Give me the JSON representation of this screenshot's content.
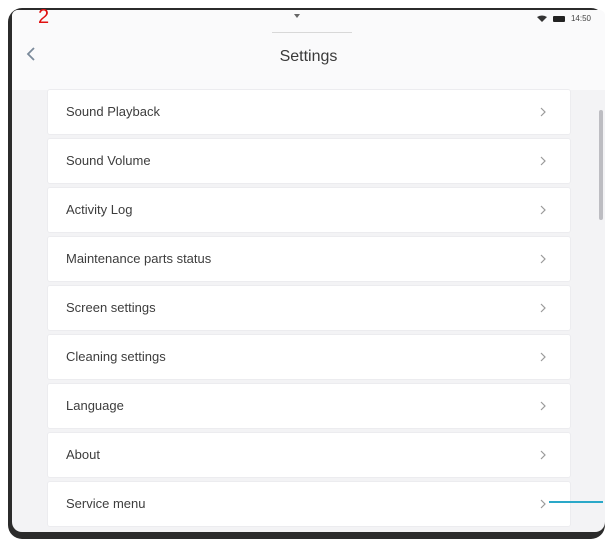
{
  "annotation": "2",
  "status_bar": {
    "time": "14:50"
  },
  "header": {
    "title": "Settings"
  },
  "menu": {
    "items": [
      {
        "label": "Sound Playback"
      },
      {
        "label": "Sound Volume"
      },
      {
        "label": "Activity Log"
      },
      {
        "label": "Maintenance parts status"
      },
      {
        "label": "Screen settings"
      },
      {
        "label": "Cleaning settings"
      },
      {
        "label": "Language"
      },
      {
        "label": "About"
      },
      {
        "label": "Service menu"
      }
    ]
  },
  "colors": {
    "annotation": "#e01010",
    "callout": "#2aa8c8",
    "background": "#f3f3f5"
  },
  "icons": [
    "back-chevron-icon",
    "chevron-right-icon",
    "wifi-icon",
    "battery-icon"
  ]
}
